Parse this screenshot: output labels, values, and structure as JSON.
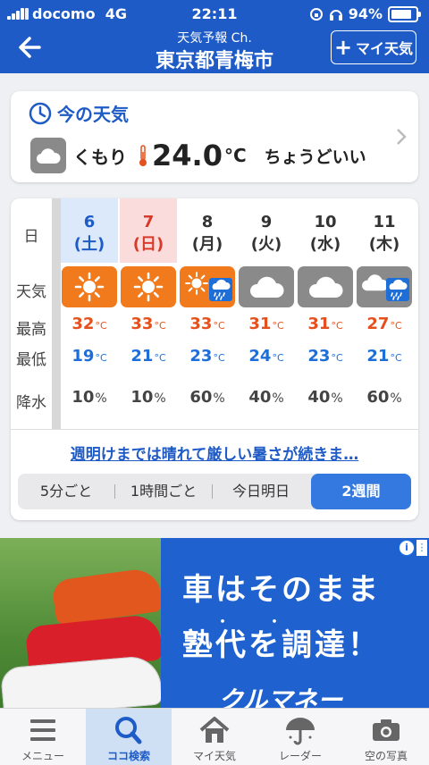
{
  "status_bar": {
    "carrier": "docomo",
    "network": "4G",
    "time": "22:11",
    "battery": "94%"
  },
  "header": {
    "back_icon": "arrow-left-icon",
    "subtitle": "天気予報 Ch.",
    "title": "東京都青梅市",
    "add_button_label": "マイ天気"
  },
  "current": {
    "heading": "今の天気",
    "condition": "くもり",
    "temperature": "24.0",
    "unit": "°C",
    "feeling": "ちょうどいい"
  },
  "forecast": {
    "row_labels": {
      "day": "日",
      "weather": "天気",
      "high": "最高",
      "low": "最低",
      "rain": "降水"
    },
    "temp_unit": "°C",
    "rain_unit": "%",
    "days": [
      {
        "date": "6",
        "weekday": "(土)",
        "icon": "sunny-icon",
        "high": "32",
        "low": "19",
        "rain": "10",
        "kind": "sat"
      },
      {
        "date": "7",
        "weekday": "(日)",
        "icon": "sunny-icon",
        "high": "33",
        "low": "21",
        "rain": "10",
        "kind": "sun"
      },
      {
        "date": "8",
        "weekday": "(月)",
        "icon": "sunny-then-rain-icon",
        "high": "33",
        "low": "23",
        "rain": "60",
        "kind": "weekday"
      },
      {
        "date": "9",
        "weekday": "(火)",
        "icon": "cloudy-icon",
        "high": "31",
        "low": "24",
        "rain": "40",
        "kind": "weekday"
      },
      {
        "date": "10",
        "weekday": "(水)",
        "icon": "cloudy-icon",
        "high": "31",
        "low": "23",
        "rain": "40",
        "kind": "weekday"
      },
      {
        "date": "11",
        "weekday": "(木)",
        "icon": "cloudy-then-rain-icon",
        "high": "27",
        "low": "21",
        "rain": "60",
        "kind": "weekday"
      }
    ],
    "summary_link": "週明けまでは晴れて厳しい暑さが続きま…",
    "tabs": [
      {
        "label": "5分ごと",
        "active": false
      },
      {
        "label": "1時間ごと",
        "active": false
      },
      {
        "label": "今日明日",
        "active": false
      },
      {
        "label": "2週間",
        "active": true
      }
    ]
  },
  "ad": {
    "line1": "車はそのまま",
    "line2": "塾代を調達！",
    "brand": "クルマネー"
  },
  "bottom_nav": [
    {
      "label": "メニュー",
      "icon": "menu-icon",
      "active": false
    },
    {
      "label": "ココ検索",
      "icon": "search-icon",
      "active": true
    },
    {
      "label": "マイ天気",
      "icon": "home-icon",
      "active": false
    },
    {
      "label": "レーダー",
      "icon": "umbrella-icon",
      "active": false
    },
    {
      "label": "空の写真",
      "icon": "camera-icon",
      "active": false
    }
  ],
  "colors": {
    "brand_blue": "#1e5bc6",
    "high_temp": "#e5511e",
    "low_temp": "#1e6ed8",
    "sunny_bg": "#f07a1c",
    "cloudy_bg": "#8a8a8a",
    "saturday_bg": "#dbe9fb",
    "sunday_bg": "#fbdcdc"
  }
}
